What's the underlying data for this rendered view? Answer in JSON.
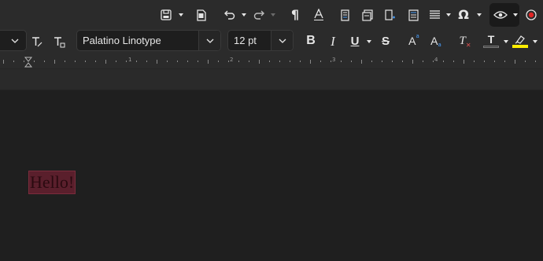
{
  "toolbar_top": {
    "icons": [
      "save-icon",
      "export-pdf-icon",
      "undo-icon",
      "redo-icon",
      "formatting-marks-icon",
      "character-icon",
      "page-break-icon",
      "text-box-icon",
      "insert-field-icon",
      "comment-icon",
      "table-icon",
      "special-character-icon",
      "track-changes-icon",
      "record-icon"
    ],
    "special_char_glyph": "Ω",
    "pilcrow_glyph": "¶"
  },
  "toolbar_format": {
    "font_name": "Palatino Linotype",
    "font_size": "12 pt",
    "bold_glyph": "B",
    "italic_glyph": "I",
    "underline_glyph": "U",
    "strike_glyph": "S",
    "superscript_glyph": "A",
    "subscript_glyph": "A",
    "clear_glyph": "T",
    "font_color_glyph": "T",
    "highlight_color": "#ffee00"
  },
  "ruler": {
    "numbers": [
      "1",
      "2",
      "3",
      "4"
    ]
  },
  "document": {
    "text": "Hello!"
  }
}
